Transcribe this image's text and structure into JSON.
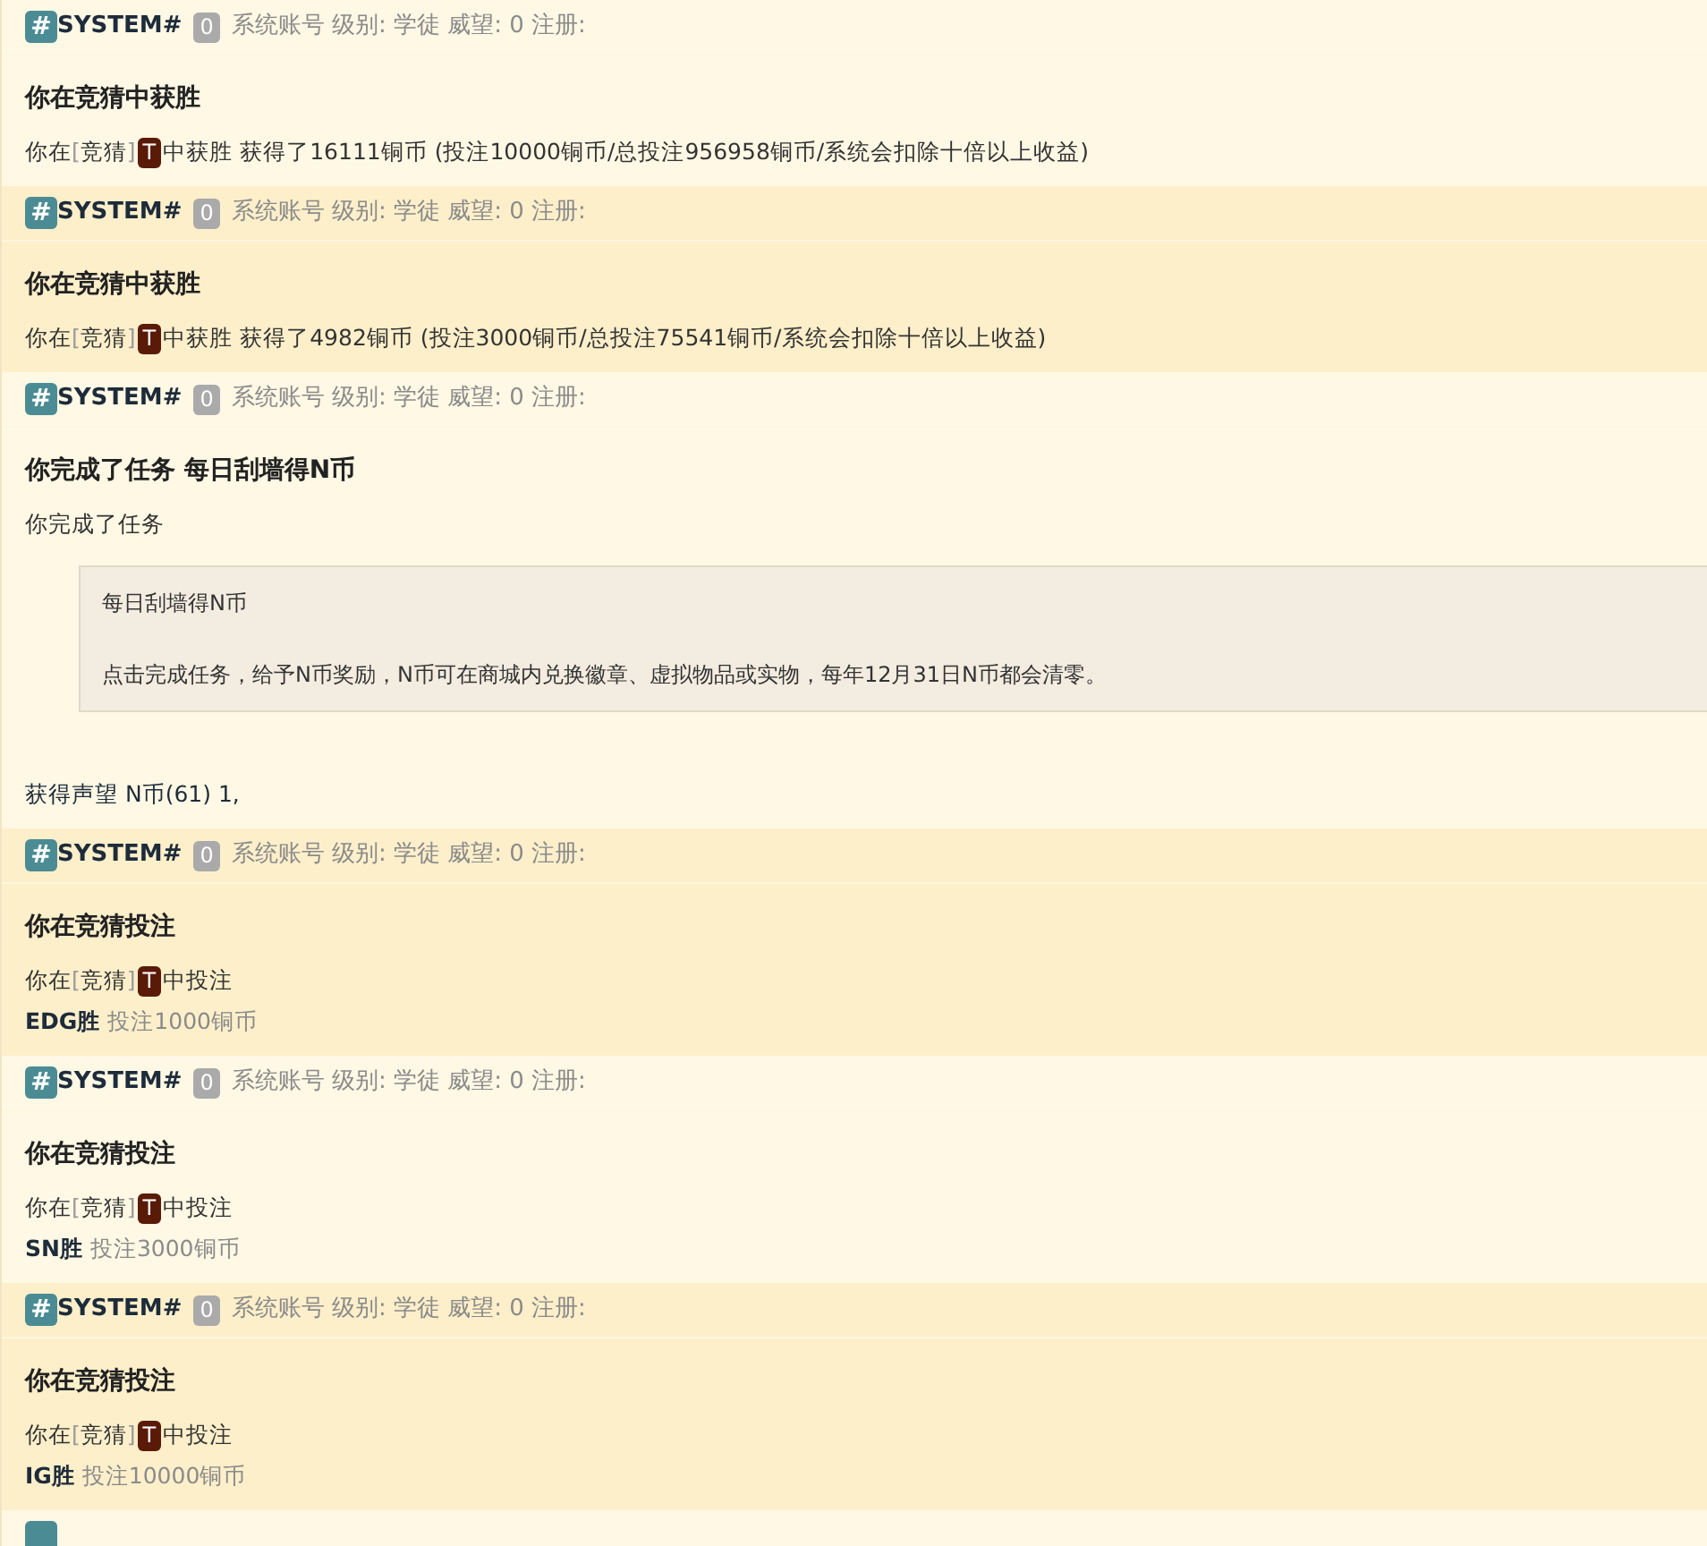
{
  "posts": [
    {
      "kind": "win",
      "header": {
        "hash": "#",
        "user": "SYSTEM#",
        "badge": "0",
        "meta": "系统账号 级别: 学徒 威望: 0 注册:"
      },
      "title": "你在竞猜中获胜",
      "line": {
        "prefix": "你在",
        "open": "[",
        "link": "竞猜",
        "close": "]",
        "tag": "T",
        "suffix": "中获胜 获得了16111铜币 (投注10000铜币/总投注956958铜币/系统会扣除十倍以上收益)"
      }
    },
    {
      "kind": "win",
      "header": {
        "hash": "#",
        "user": "SYSTEM#",
        "badge": "0",
        "meta": "系统账号 级别: 学徒 威望: 0 注册:"
      },
      "title": "你在竞猜中获胜",
      "line": {
        "prefix": "你在",
        "open": "[",
        "link": "竞猜",
        "close": "]",
        "tag": "T",
        "suffix": "中获胜 获得了4982铜币 (投注3000铜币/总投注75541铜币/系统会扣除十倍以上收益)"
      }
    },
    {
      "kind": "task",
      "header": {
        "hash": "#",
        "user": "SYSTEM#",
        "badge": "0",
        "meta": "系统账号 级别: 学徒 威望: 0 注册:"
      },
      "title": "你完成了任务 每日刮墙得N币",
      "text": "你完成了任务",
      "quote": [
        "每日刮墙得N币",
        "点击完成任务，给予N币奖励，N币可在商城内兑换徽章、虚拟物品或实物，每年12月31日N币都会清零。"
      ],
      "reward": "获得声望 N币(61) 1,"
    },
    {
      "kind": "bet",
      "header": {
        "hash": "#",
        "user": "SYSTEM#",
        "badge": "0",
        "meta": "系统账号 级别: 学徒 威望: 0 注册:"
      },
      "title": "你在竞猜投注",
      "line": {
        "prefix": "你在",
        "open": "[",
        "link": "竞猜",
        "close": "]",
        "tag": "T",
        "suffix": "中投注"
      },
      "pick": "EDG胜",
      "amount": "投注1000铜币"
    },
    {
      "kind": "bet",
      "header": {
        "hash": "#",
        "user": "SYSTEM#",
        "badge": "0",
        "meta": "系统账号 级别: 学徒 威望: 0 注册:"
      },
      "title": "你在竞猜投注",
      "line": {
        "prefix": "你在",
        "open": "[",
        "link": "竞猜",
        "close": "]",
        "tag": "T",
        "suffix": "中投注"
      },
      "pick": "SN胜",
      "amount": "投注3000铜币"
    },
    {
      "kind": "bet",
      "header": {
        "hash": "#",
        "user": "SYSTEM#",
        "badge": "0",
        "meta": "系统账号 级别: 学徒 威望: 0 注册:"
      },
      "title": "你在竞猜投注",
      "line": {
        "prefix": "你在",
        "open": "[",
        "link": "竞猜",
        "close": "]",
        "tag": "T",
        "suffix": "中投注"
      },
      "pick": "IG胜",
      "amount": "投注10000铜币"
    },
    {
      "kind": "stub"
    }
  ]
}
